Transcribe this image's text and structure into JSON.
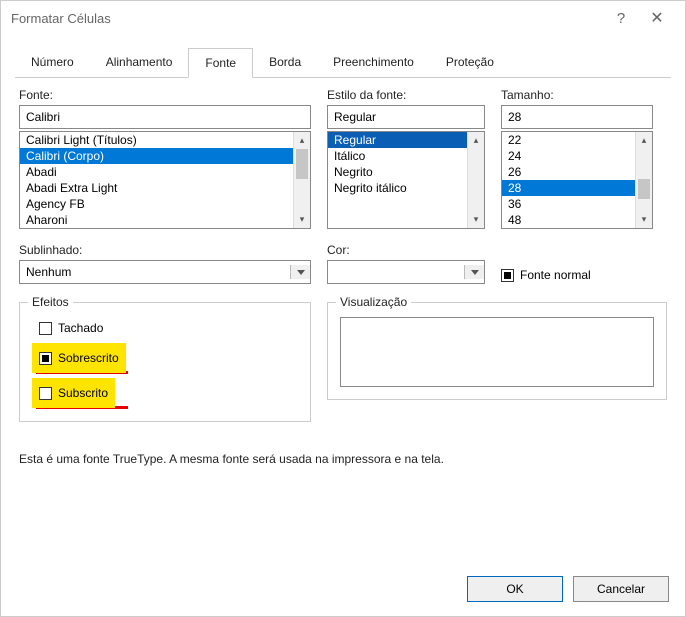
{
  "window": {
    "title": "Formatar Células"
  },
  "tabs": {
    "items": [
      "Número",
      "Alinhamento",
      "Fonte",
      "Borda",
      "Preenchimento",
      "Proteção"
    ],
    "active_index": 2
  },
  "font": {
    "label": "Fonte:",
    "value": "Calibri",
    "list": [
      "Calibri Light (Títulos)",
      "Calibri (Corpo)",
      "Abadi",
      "Abadi Extra Light",
      "Agency FB",
      "Aharoni"
    ],
    "selected_index": 1
  },
  "style": {
    "label": "Estilo da fonte:",
    "value": "Regular",
    "list": [
      "Regular",
      "Itálico",
      "Negrito",
      "Negrito itálico"
    ],
    "selected_index": 0
  },
  "size": {
    "label": "Tamanho:",
    "value": "28",
    "list": [
      "22",
      "24",
      "26",
      "28",
      "36",
      "48"
    ],
    "selected_index": 3
  },
  "underline": {
    "label": "Sublinhado:",
    "value": "Nenhum"
  },
  "color": {
    "label": "Cor:"
  },
  "normal_font": {
    "label": "Fonte normal"
  },
  "effects": {
    "legend": "Efeitos",
    "strike": "Tachado",
    "super": "Sobrescrito",
    "sub": "Subscrito"
  },
  "preview": {
    "legend": "Visualização"
  },
  "footer": "Esta é uma fonte TrueType. A mesma fonte será usada na impressora e na tela.",
  "buttons": {
    "ok": "OK",
    "cancel": "Cancelar"
  }
}
